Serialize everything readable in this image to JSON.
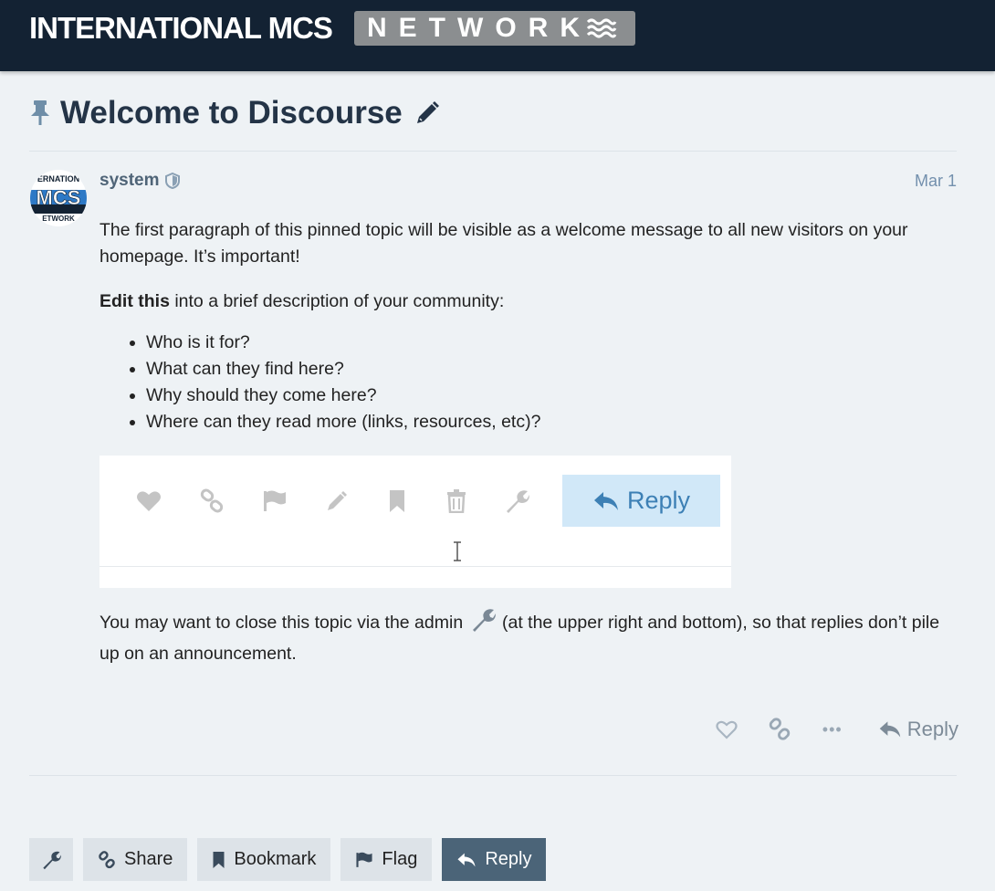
{
  "header": {
    "logo_main": "INTERNATIONAL MCS",
    "logo_network": "NETWORK"
  },
  "topic": {
    "title": "Welcome to Discourse",
    "pinned": true
  },
  "post": {
    "username": "system",
    "date": "Mar 1",
    "avatar_text_top": "ERNATION",
    "avatar_text_mid": "MCS",
    "avatar_text_bot": "ETWORK",
    "paragraph1": "The first paragraph of this pinned topic will be visible as a welcome message to all new visitors on your homepage. It’s important!",
    "edit_bold": "Edit this",
    "edit_rest": " into a brief description of your community:",
    "bullets": [
      "Who is it for?",
      "What can they find here?",
      "Why should they come here?",
      "Where can they read more (links, resources, etc)?"
    ],
    "embed_reply_label": "Reply",
    "close_text_before": "You may want to close this topic via the admin ",
    "close_text_after": " (at the upper right and bottom), so that replies don’t pile up on an announcement.",
    "actions": {
      "more": "•••",
      "reply": "Reply"
    }
  },
  "footer": {
    "share": "Share",
    "bookmark": "Bookmark",
    "flag": "Flag",
    "reply": "Reply"
  },
  "colors": {
    "header_bg": "#132233",
    "page_bg": "#eef2f5",
    "primary_button": "#4b6478",
    "link_muted": "#7390ad"
  }
}
